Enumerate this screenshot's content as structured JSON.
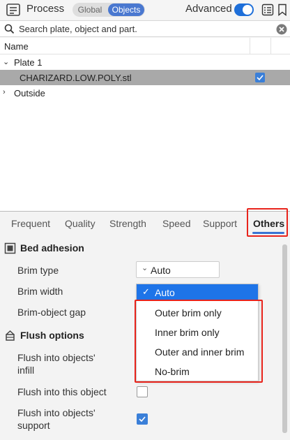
{
  "header": {
    "title": "Process",
    "segment": {
      "global": "Global",
      "objects": "Objects",
      "active": "Objects"
    },
    "advanced_label": "Advanced",
    "advanced_on": true,
    "accent": "#1e6fd9"
  },
  "search": {
    "placeholder": "Search plate, object and part."
  },
  "tree": {
    "column_name": "Name",
    "plate": "Plate 1",
    "object": "CHARIZARD.LOW.POLY.stl",
    "object_checked": true,
    "outside": "Outside"
  },
  "tabs": [
    {
      "label": "Frequent"
    },
    {
      "label": "Quality"
    },
    {
      "label": "Strength"
    },
    {
      "label": "Speed"
    },
    {
      "label": "Support"
    },
    {
      "label": "Others"
    }
  ],
  "active_tab": "Others",
  "bed_adhesion": {
    "title": "Bed adhesion",
    "brim_type_label": "Brim type",
    "brim_type_value": "Auto",
    "brim_width_label": "Brim width",
    "brim_gap_label": "Brim-object gap",
    "dropdown_options": [
      "Auto",
      "Outer brim only",
      "Inner brim only",
      "Outer and inner brim",
      "No-brim"
    ],
    "dropdown_selected": "Auto"
  },
  "flush_options": {
    "title": "Flush options",
    "infill_label": "Flush into objects' infill",
    "infill_line1": "Flush into objects'",
    "infill_line2": "infill",
    "this_object_label": "Flush into this object",
    "this_object_checked": false,
    "support_line1": "Flush into objects'",
    "support_line2": "support",
    "support_checked": true
  },
  "highlight_color": "#e8231b",
  "selection_color": "#1e74e8"
}
